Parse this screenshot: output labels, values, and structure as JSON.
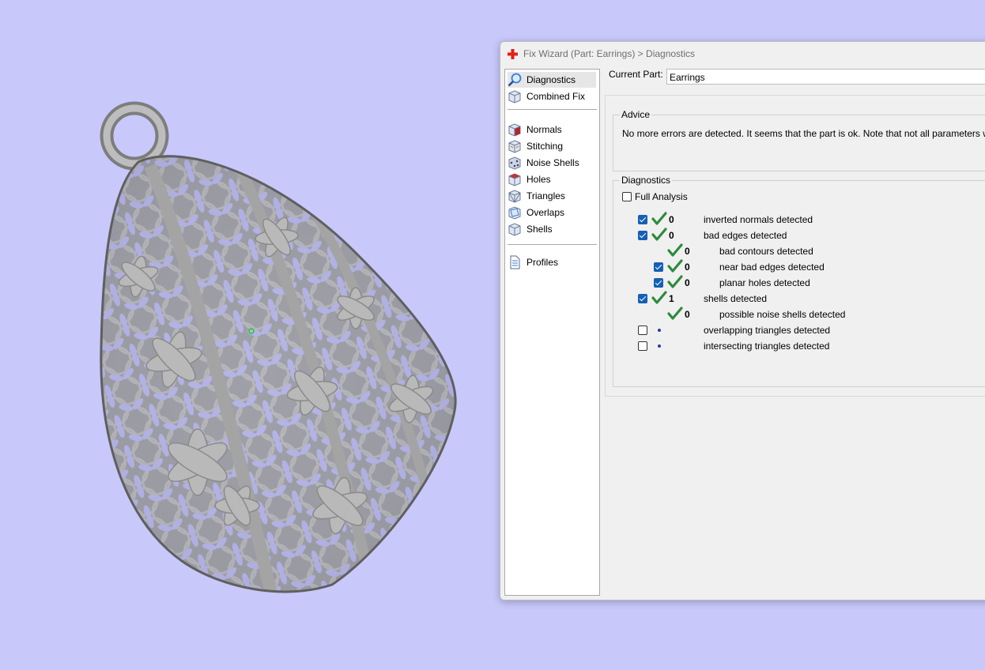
{
  "dialog": {
    "title": "Fix Wizard (Part: Earrings) > Diagnostics",
    "current_part_label": "Current Part:",
    "current_part_value": "Earrings"
  },
  "nav": {
    "items": [
      {
        "label": "Diagnostics",
        "icon": "magnifier-icon",
        "active": true
      },
      {
        "label": "Combined Fix",
        "icon": "cube-icon"
      },
      {
        "label": "Normals",
        "icon": "normals-cube-icon"
      },
      {
        "label": "Stitching",
        "icon": "stitching-cube-icon"
      },
      {
        "label": "Noise Shells",
        "icon": "noise-shells-icon"
      },
      {
        "label": "Holes",
        "icon": "holes-cube-icon"
      },
      {
        "label": "Triangles",
        "icon": "triangles-cube-icon"
      },
      {
        "label": "Overlaps",
        "icon": "overlaps-cube-icon"
      },
      {
        "label": "Shells",
        "icon": "shells-cube-icon"
      },
      {
        "label": "Profiles",
        "icon": "document-icon"
      }
    ]
  },
  "advice": {
    "legend": "Advice",
    "text": "No more errors are detected. It seems that the part is ok. Note that not all parameters were an"
  },
  "diagnostics": {
    "legend": "Diagnostics",
    "full_analysis_label": "Full Analysis",
    "full_analysis_checked": false,
    "rows": [
      {
        "checked": true,
        "status": "ok",
        "count": "0",
        "label": "inverted normals detected"
      },
      {
        "checked": true,
        "status": "ok",
        "count": "0",
        "label": "bad edges detected"
      },
      {
        "checkbox": false,
        "status": "ok",
        "count": "0",
        "label": "bad contours detected",
        "indent": true
      },
      {
        "checked": true,
        "status": "ok",
        "count": "0",
        "label": "near bad edges detected",
        "indent": true
      },
      {
        "checked": true,
        "status": "ok",
        "count": "0",
        "label": "planar holes detected",
        "indent": true
      },
      {
        "checked": true,
        "status": "ok",
        "count": "1",
        "label": "shells detected"
      },
      {
        "checkbox": false,
        "status": "ok",
        "count": "0",
        "label": "possible noise shells detected",
        "indent": true
      },
      {
        "checked": false,
        "status": "pending",
        "count": "",
        "label": "overlapping triangles detected"
      },
      {
        "checked": false,
        "status": "pending",
        "count": "",
        "label": "intersecting triangles detected"
      }
    ]
  },
  "colors": {
    "background": "#c8c8fb",
    "check_green": "#2e8b3a",
    "checkbox_blue": "#1460b4"
  }
}
